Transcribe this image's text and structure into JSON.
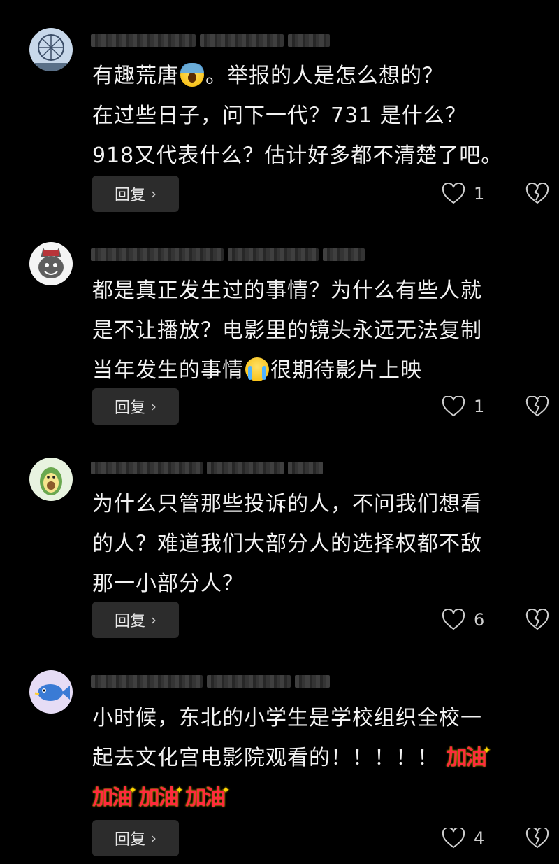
{
  "comments": [
    {
      "text_a": "有趣荒唐",
      "text_b": "。举报的人是怎么想的？\n在过些日子，问下一代？731 是什么？\n918又代表什么？估计好多都不清楚了吧。",
      "reply_label": "回复",
      "like_count": "1",
      "avatar_icon": "ferris-wheel-avatar"
    },
    {
      "text_a": "都是真正发生过的事情？为什么有些人就\n是不让播放？电影里的镜头永远无法复制\n当年发生的事情",
      "text_b": "很期待影片上映",
      "reply_label": "回复",
      "like_count": "1",
      "avatar_icon": "gray-wolf-avatar"
    },
    {
      "text_a": "为什么只管那些投诉的人，不问我们想看\n的人？难道我们大部分人的选择权都不敌\n那一小部分人？",
      "reply_label": "回复",
      "like_count": "6",
      "avatar_icon": "avocado-avatar"
    },
    {
      "text_a": "小时候，东北的小学生是学校组织全校一\n起去文化宫电影院观看的！！！！！",
      "jiayou": "加油",
      "reply_label": "回复",
      "like_count": "4",
      "avatar_icon": "fish-avatar"
    }
  ],
  "colors": {
    "background": "#000000",
    "text": "#f2f2f2",
    "reply_button_bg": "#2c2c2c",
    "jiayou_red": "#ff2a3d"
  },
  "icons": {
    "like": "heart-outline-icon",
    "dislike": "broken-heart-icon",
    "reply_chevron": "chevron-right-icon"
  },
  "chevron": "›"
}
